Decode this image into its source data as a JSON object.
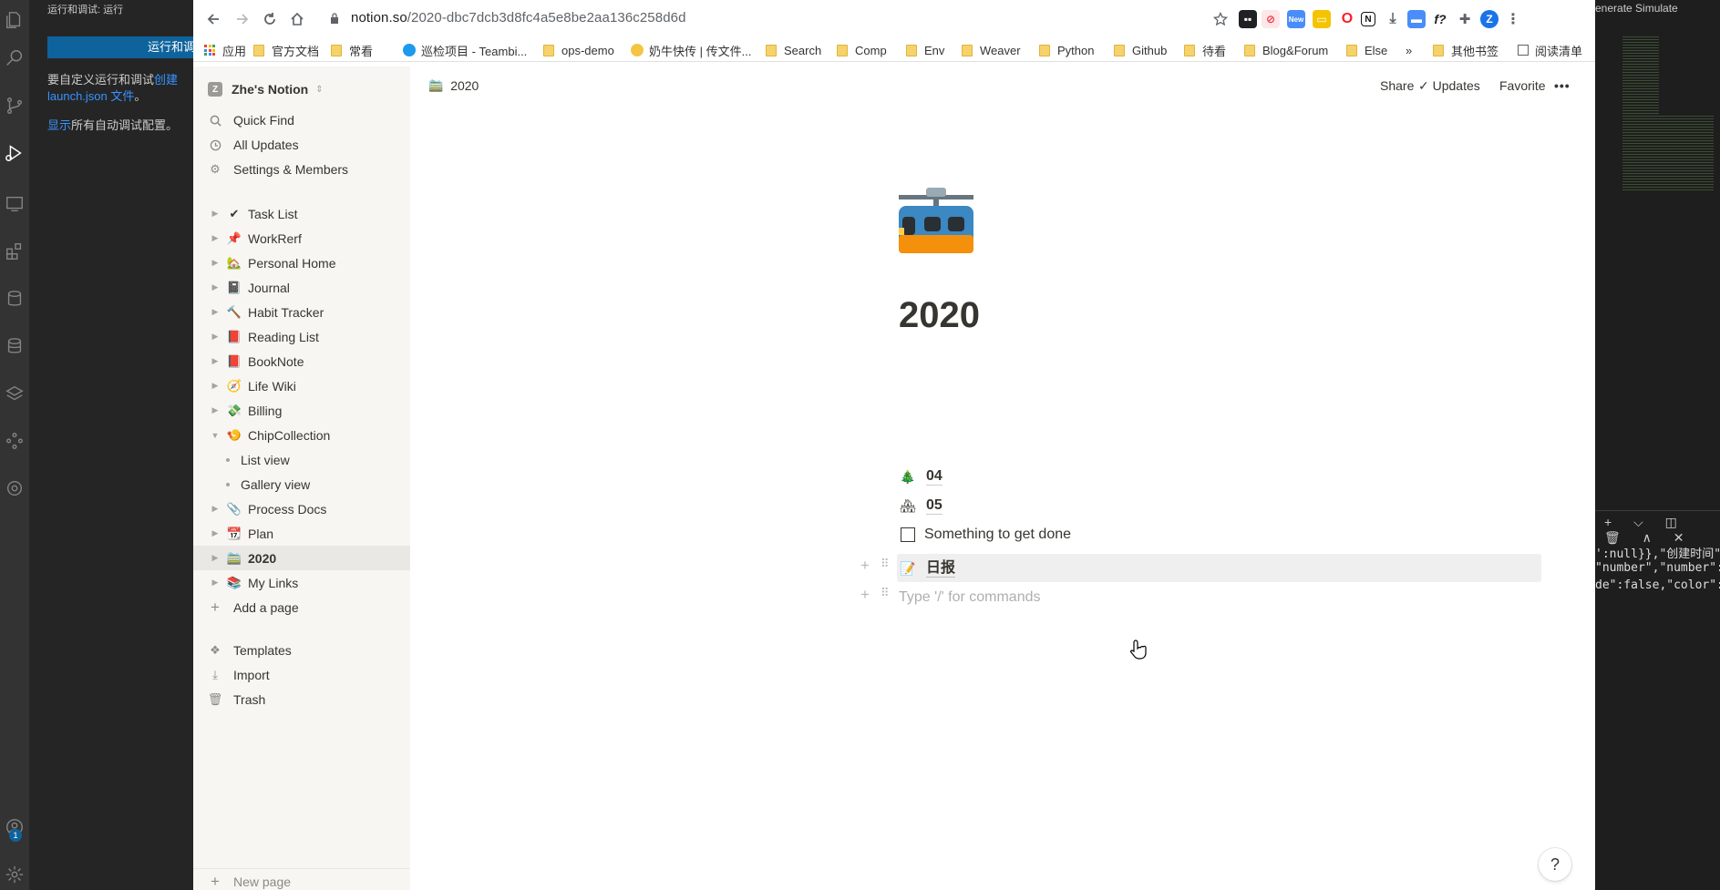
{
  "vscode": {
    "sidebar_title": "运行和调试: 运行",
    "run_button": "运行和调试",
    "info_prefix": "要自定义运行和调试",
    "info_link": "创建 launch.json 文件",
    "info_suffix": "。",
    "show_link": "显示",
    "show_rest": "所有自动调试配置。",
    "top_right_actions": "enerate  Simulate",
    "panel_lines": [
      "':null}},\"创建时间\"",
      "\"number\",\"number\":-",
      "de\":false,\"color\":\""
    ],
    "badge_count": "1"
  },
  "browser": {
    "url_host": "notion.so",
    "url_path": "/2020-dbc7dcb3d8fc4a5e8be2aa136c258d6d",
    "profile_initial": "Z",
    "ext_new_label": "New",
    "bookmarks": [
      "应用",
      "官方文档",
      "常看",
      "巡检项目 - Teambi...",
      "ops-demo",
      "奶牛快传 | 传文件...",
      "Search",
      "Comp",
      "Env",
      "Weaver",
      "Python",
      "Github",
      "待看",
      "Blog&Forum",
      "Else",
      "其他书签",
      "阅读清单"
    ],
    "more_bookmarks": "»"
  },
  "notion": {
    "workspace": "Zhe's Notion",
    "workspace_initial": "Z",
    "nav": {
      "quick_find": "Quick Find",
      "all_updates": "All Updates",
      "settings": "Settings & Members"
    },
    "pages": [
      {
        "emoji": "✔",
        "label": "Task List"
      },
      {
        "emoji": "📌",
        "label": "WorkRerf"
      },
      {
        "emoji": "🏡",
        "label": "Personal Home"
      },
      {
        "emoji": "📓",
        "label": "Journal"
      },
      {
        "emoji": "🔨",
        "label": "Habit Tracker"
      },
      {
        "emoji": "📕",
        "label": "Reading List"
      },
      {
        "emoji": "📕",
        "label": "BookNote"
      },
      {
        "emoji": "🧭",
        "label": "Life Wiki"
      },
      {
        "emoji": "💸",
        "label": "Billing"
      },
      {
        "emoji": "🍤",
        "label": "ChipCollection"
      }
    ],
    "subpages": [
      "List view",
      "Gallery view"
    ],
    "pages2": [
      {
        "emoji": "📎",
        "label": "Process Docs"
      },
      {
        "emoji": "📆",
        "label": "Plan"
      },
      {
        "emoji": "🚞",
        "label": "2020"
      },
      {
        "emoji": "📚",
        "label": "My Links"
      }
    ],
    "add_page": "Add a page",
    "templates": "Templates",
    "import": "Import",
    "trash": "Trash",
    "new_page": "New page",
    "breadcrumb": "2020",
    "top_actions": {
      "share": "Share",
      "updates": "Updates",
      "favorite": "Favorite",
      "more": "•••"
    },
    "page_title": "2020",
    "blocks": {
      "link1_emoji": "🎄",
      "link1": "04",
      "link2_emoji": "🏘",
      "link2": "05",
      "todo": "Something to get done",
      "link3_emoji": "📝",
      "link3": "日报",
      "placeholder": "Type '/' for commands"
    },
    "help": "?"
  },
  "colors": {
    "vscode_activity": "#333333",
    "vscode_sidebar": "#252526",
    "vscode_button": "#0e639c",
    "notion_sidebar": "#f7f6f3",
    "notion_text": "#37352f"
  }
}
